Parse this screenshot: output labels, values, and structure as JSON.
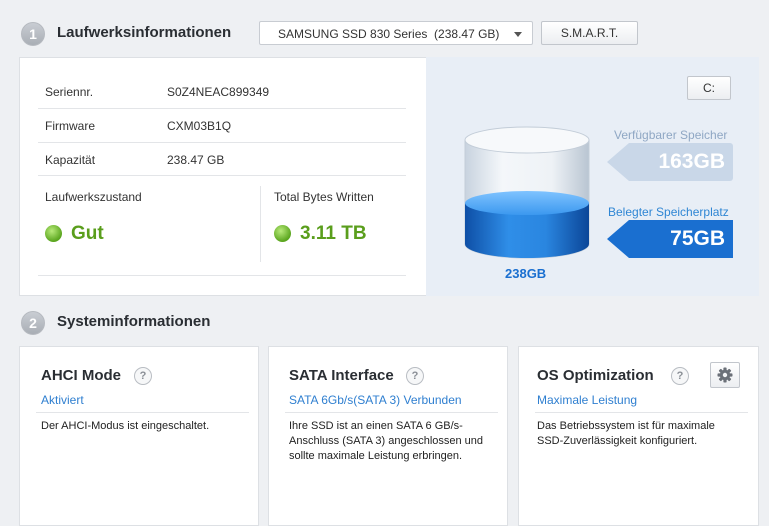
{
  "drive_section": {
    "number": "1",
    "title": "Laufwerksinformationen",
    "drive_select_value": "SAMSUNG SSD 830 Series  (238.47 GB)",
    "smart_button": "S.M.A.R.T."
  },
  "drive_info": {
    "serial_label": "Seriennr.",
    "serial_value": "S0Z4NEAC899349",
    "firmware_label": "Firmware",
    "firmware_value": "CXM03B1Q",
    "capacity_label": "Kapazität",
    "capacity_value": "238.47 GB",
    "health_label": "Laufwerkszustand",
    "health_value": "Gut",
    "tbw_label": "Total Bytes Written",
    "tbw_value": "3.11 TB"
  },
  "capacity": {
    "drive_letter_button": "C:",
    "free_label": "Verfügbarer Speicher",
    "free_value": "163GB",
    "used_label": "Belegter Speicherplatz",
    "used_value": "75GB",
    "total_value": "238GB",
    "used_fraction": 0.315
  },
  "system_section": {
    "number": "2",
    "title": "Systeminformationen"
  },
  "cards": [
    {
      "title": "AHCI Mode",
      "help": "?",
      "status": "Aktiviert",
      "text": "Der AHCI-Modus ist eingeschaltet."
    },
    {
      "title": "SATA Interface",
      "help": "?",
      "status": "SATA 6Gb/s(SATA 3) Verbunden",
      "text": "Ihre SSD ist an einen SATA 6 GB/s-Anschluss (SATA 3) angeschlossen und sollte maximale Leistung erbringen."
    },
    {
      "title": "OS Optimization",
      "help": "?",
      "status": "Maximale Leistung",
      "text": "Das Betriebssystem ist für maximale SSD-Zuverlässigkeit konfiguriert."
    }
  ],
  "colors": {
    "accent_blue": "#1a6fd0",
    "good_green": "#5a9e1c",
    "link_blue": "#2f7fd0"
  }
}
